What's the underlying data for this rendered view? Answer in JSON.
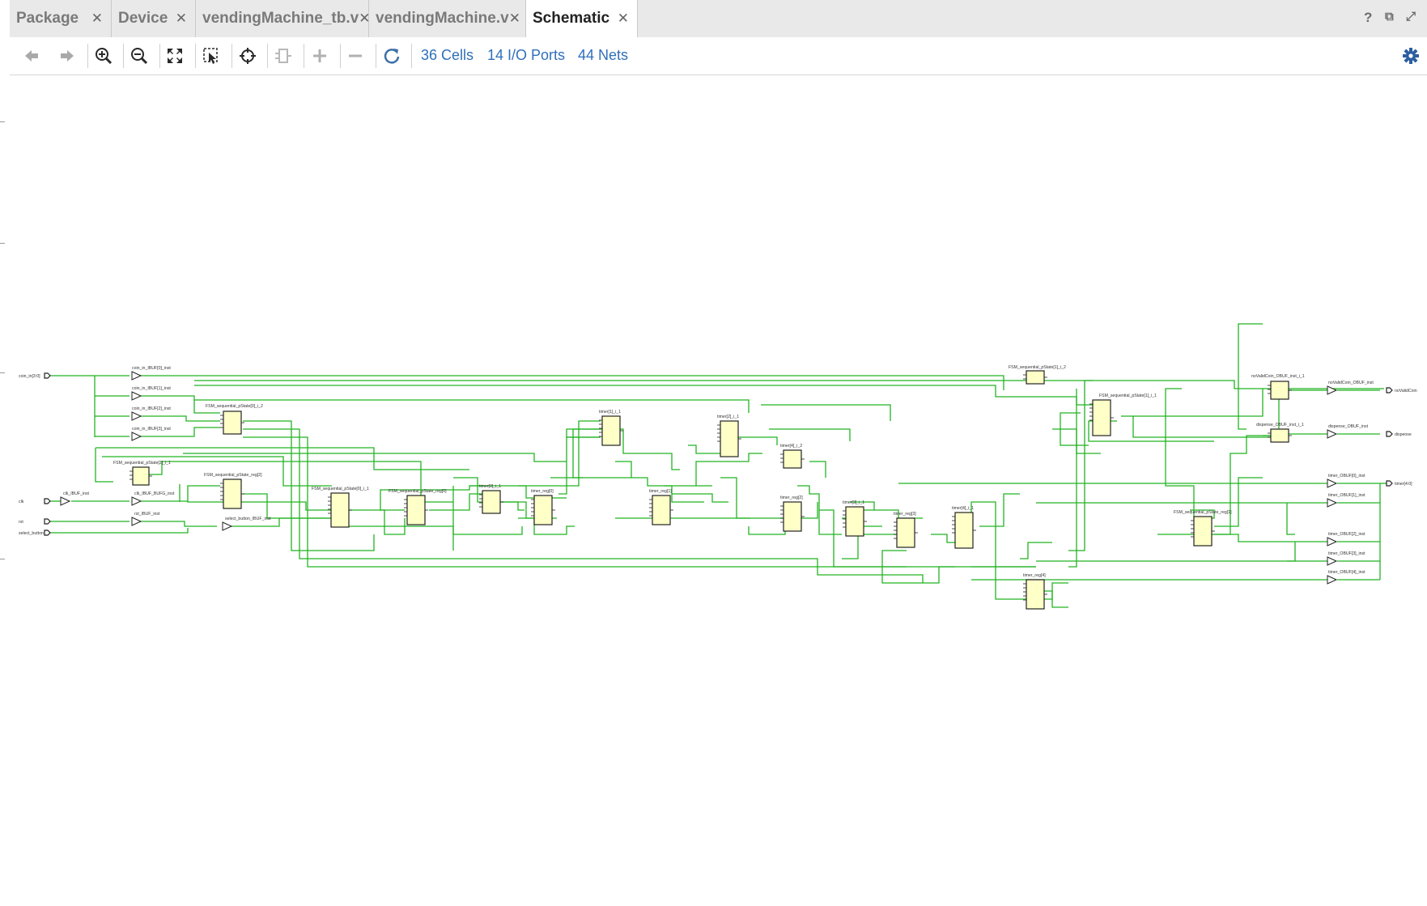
{
  "tabs": [
    {
      "label": "Package",
      "close": "✕",
      "active": false
    },
    {
      "label": "Device",
      "close": "✕",
      "active": false
    },
    {
      "label": "vendingMachine_tb.v",
      "close": "✕",
      "active": false
    },
    {
      "label": "vendingMachine.v",
      "close": "✕",
      "active": false
    },
    {
      "label": "Schematic",
      "close": "✕",
      "active": true
    }
  ],
  "window_controls": {
    "help": "?",
    "restore": "⧉",
    "maximize": "⤢"
  },
  "toolbar": {
    "icons": [
      "back-arrow-icon",
      "forward-arrow-icon",
      "zoom-in-icon",
      "zoom-out-icon",
      "fit-view-icon",
      "zoom-area-icon",
      "select-object-icon",
      "cell-expand-icon",
      "add-icon",
      "remove-icon",
      "refresh-icon"
    ],
    "cells_link": "36 Cells",
    "ports_link": "14 I/O Ports",
    "nets_link": "44 Nets",
    "settings_icon": "gear-icon"
  },
  "colors": {
    "wire": "#22b422",
    "cell_fill": "#ffffc8",
    "link": "#2f6fb9",
    "settings": "#2c5fa0"
  },
  "schematic": {
    "input_ports": [
      "coin_in[3:0]",
      "clk",
      "rst",
      "select_button"
    ],
    "output_ports": [
      "noValidCoin",
      "dispense",
      "timer[4:0]"
    ],
    "buffers": [
      "coin_in_IBUF[0]_inst",
      "coin_in_IBUF[1]_inst",
      "coin_in_IBUF[2]_inst",
      "coin_in_IBUF[3]_inst",
      "clk_IBUF_inst",
      "clk_IBUF_BUFG_inst",
      "rst_IBUF_inst",
      "select_button_IBUF_inst",
      "noValidCoin_OBUF_inst",
      "dispense_OBUF_inst",
      "timer_OBUF[0]_inst",
      "timer_OBUF[1]_inst",
      "timer_OBUF[2]_inst",
      "timer_OBUF[3]_inst",
      "timer_OBUF[4]_inst"
    ],
    "cells": [
      "FSM_sequential_pState[0]_i_2",
      "FSM_sequential_pState[2]_i_1",
      "FSM_sequential_pState_reg[2]",
      "FSM_sequential_pState[0]_i_1",
      "FSM_sequential_pState_reg[0]",
      "timer[0]_i_1",
      "timer_reg[0]",
      "timer[1]_i_1",
      "timer_reg[1]",
      "timer[2]_i_1",
      "timer[4]_i_2",
      "timer_reg[2]",
      "timer[3]_i_1",
      "timer_reg[3]",
      "timer[4]_i_1",
      "timer_reg[4]",
      "FSM_sequential_pState[1]_i_2",
      "FSM_sequential_pState[1]_i_1",
      "FSM_sequential_pState_reg[1]",
      "noValidCoin_OBUF_inst_i_1",
      "dispense_OBUF_inst_i_1"
    ]
  }
}
